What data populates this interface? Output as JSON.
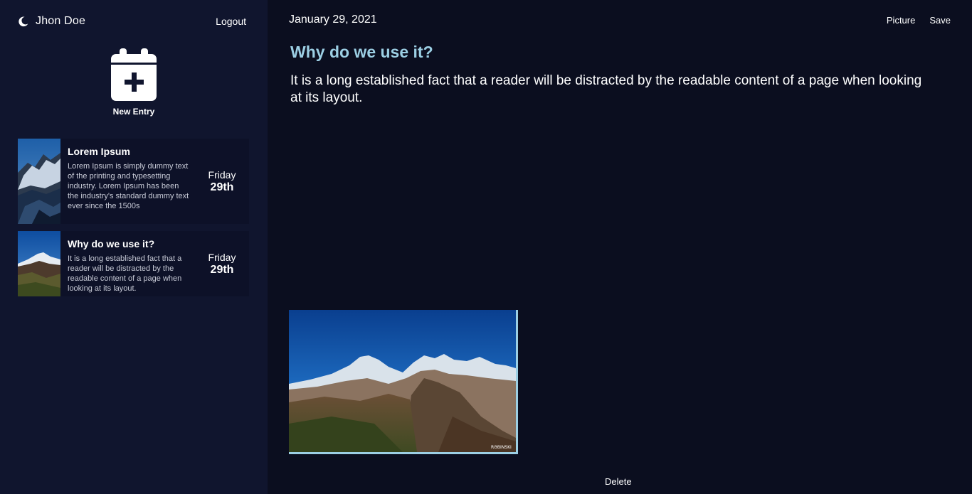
{
  "sidebar": {
    "user_name": "Jhon Doe",
    "logout_label": "Logout",
    "new_entry_label": "New Entry",
    "entries": [
      {
        "title": "Lorem Ipsum",
        "excerpt": "Lorem Ipsum is simply dummy text of the printing and typesetting industry. Lorem Ipsum has been the industry's standard dummy text ever since the 1500s",
        "day": "Friday",
        "date": "29th"
      },
      {
        "title": "Why do we use it?",
        "excerpt": "It is a long established fact that a reader will be distracted by the readable content of a page when looking at its layout.",
        "day": "Friday",
        "date": "29th"
      }
    ]
  },
  "main": {
    "date": "January 29, 2021",
    "actions": {
      "picture_label": "Picture",
      "save_label": "Save"
    },
    "title": "Why do we use it?",
    "body": "It is a long established fact that a reader will be distracted by the readable content of a page when looking at its layout.",
    "delete_label": "Delete"
  },
  "icons": {
    "theme": "moon-icon",
    "new_entry": "calendar-plus-icon"
  },
  "colors": {
    "sidebar_bg": "#10152e",
    "main_bg": "#0b0e1f",
    "accent": "#9ccfe4"
  }
}
